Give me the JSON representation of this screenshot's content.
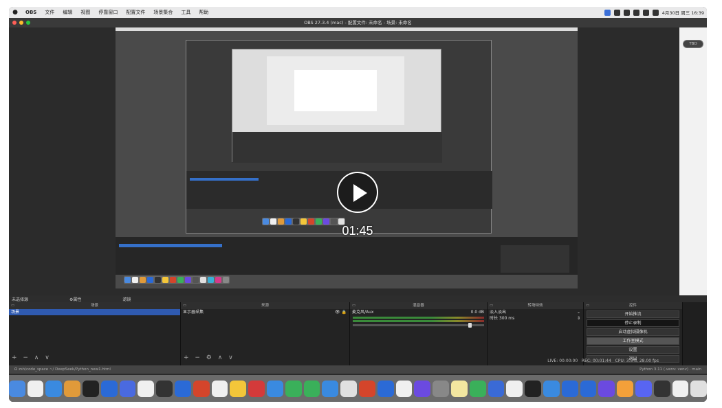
{
  "menubar": {
    "apple_icon": "apple-icon",
    "items": [
      "OBS",
      "文件",
      "编辑",
      "视图",
      "停靠窗口",
      "配置文件",
      "场景集合",
      "工具",
      "帮助"
    ],
    "clock": "4月30日 周三 16:39"
  },
  "window": {
    "title": "OBS 27.3.4 (mac) - 配置文件: 未命名 - 场景: 未命名"
  },
  "right_panel": {
    "mode_button": "TBD"
  },
  "video": {
    "timestamp": "01:45",
    "play_icon": "play-icon"
  },
  "docks": {
    "scene_bar": {
      "title": "未选择源",
      "properties": "⚙属性",
      "filters": "滤镜"
    },
    "scenes": {
      "header": "场景",
      "selected": "场景"
    },
    "sources": {
      "header": "来源",
      "item": "显示器采集"
    },
    "mixer": {
      "header": "混音器",
      "track": "麦克风/Aux",
      "level": "0.0 dB"
    },
    "transitions": {
      "header": "转场特效",
      "type": "淡入淡出",
      "duration_label": "时长",
      "duration_value": "300 ms"
    },
    "controls": {
      "header": "控件",
      "buttons": [
        "开始推流",
        "停止录制",
        "启动虚拟摄像机",
        "工作室模式",
        "设置",
        "退出"
      ]
    }
  },
  "status": {
    "live": "LIVE: 00:00:00",
    "rec": "REC: 00:01:44",
    "cpu": "CPU: 3.3%, 28.00 fps",
    "left_path": "Ω zsh/code_space  ~/ DeepSeek/Python_new1.html",
    "right_info": "Python 3.11 (.venv: venv) · main"
  },
  "colors": {
    "accent": "#2f5ab0",
    "obs_dark": "#1f1f1f"
  }
}
